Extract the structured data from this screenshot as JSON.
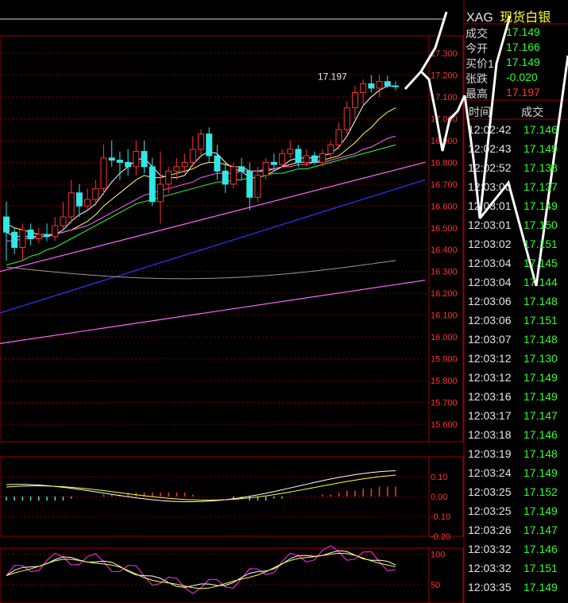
{
  "header": {
    "symbol": "XAG",
    "name": "现货白银"
  },
  "quote": [
    {
      "label": "成交",
      "value": "17.149",
      "color": "#33ff33"
    },
    {
      "label": "今开",
      "value": "17.166",
      "color": "#33ff33"
    },
    {
      "label": "买价1",
      "value": "17.149",
      "color": "#33ff33"
    },
    {
      "label": "张跌",
      "value": "-0.020",
      "color": "#33ff33"
    },
    {
      "label": "最高",
      "value": "17.197",
      "color": "#ff3333"
    }
  ],
  "ticks_header": {
    "time": "时间",
    "volume": "成交"
  },
  "ticks": [
    {
      "time": "12:02:42",
      "price": "17.146"
    },
    {
      "time": "12:02:43",
      "price": "17.149"
    },
    {
      "time": "12:02:52",
      "price": "17.138"
    },
    {
      "time": "12:03:00",
      "price": "17.137"
    },
    {
      "time": "12:03:01",
      "price": "17.149"
    },
    {
      "time": "12:03:01",
      "price": "17.150"
    },
    {
      "time": "12:03:02",
      "price": "17.151"
    },
    {
      "time": "12:03:04",
      "price": "17.145"
    },
    {
      "time": "12:03:04",
      "price": "17.144"
    },
    {
      "time": "12:03:06",
      "price": "17.148"
    },
    {
      "time": "12:03:06",
      "price": "17.151"
    },
    {
      "time": "12:03:07",
      "price": "17.148"
    },
    {
      "time": "12:03:12",
      "price": "17.130"
    },
    {
      "time": "12:03:12",
      "price": "17.149"
    },
    {
      "time": "12:03:16",
      "price": "17.149"
    },
    {
      "time": "12:03:17",
      "price": "17.147"
    },
    {
      "time": "12:03:18",
      "price": "17.146"
    },
    {
      "time": "12:03:19",
      "price": "17.148"
    },
    {
      "time": "12:03:24",
      "price": "17.149"
    },
    {
      "time": "12:03:25",
      "price": "17.152"
    },
    {
      "time": "12:03:25",
      "price": "17.149"
    },
    {
      "time": "12:03:26",
      "price": "17.147"
    },
    {
      "time": "12:03:32",
      "price": "17.146"
    },
    {
      "time": "12:03:32",
      "price": "17.151"
    },
    {
      "time": "12:03:35",
      "price": "17.149"
    }
  ],
  "chart_data": [
    {
      "type": "candlestick",
      "ylim": [
        15.52,
        17.38
      ],
      "y_ticks": [
        "17.300",
        "17.200",
        "17.100",
        "17.000",
        "16.900",
        "16.800",
        "16.700",
        "16.600",
        "16.500",
        "16.400",
        "16.300",
        "16.200",
        "16.100",
        "16.000",
        "15.900",
        "15.800",
        "15.700",
        "15.600"
      ],
      "annotation": "17.197",
      "candles": [
        {
          "o": 16.55,
          "h": 16.62,
          "l": 16.35,
          "c": 16.48
        },
        {
          "o": 16.48,
          "h": 16.5,
          "l": 16.38,
          "c": 16.41
        },
        {
          "o": 16.41,
          "h": 16.52,
          "l": 16.35,
          "c": 16.49
        },
        {
          "o": 16.49,
          "h": 16.52,
          "l": 16.42,
          "c": 16.45
        },
        {
          "o": 16.45,
          "h": 16.5,
          "l": 16.43,
          "c": 16.47
        },
        {
          "o": 16.47,
          "h": 16.52,
          "l": 16.44,
          "c": 16.46
        },
        {
          "o": 16.46,
          "h": 16.55,
          "l": 16.44,
          "c": 16.51
        },
        {
          "o": 16.51,
          "h": 16.62,
          "l": 16.49,
          "c": 16.55
        },
        {
          "o": 16.55,
          "h": 16.72,
          "l": 16.52,
          "c": 16.66
        },
        {
          "o": 16.66,
          "h": 16.7,
          "l": 16.55,
          "c": 16.6
        },
        {
          "o": 16.6,
          "h": 16.68,
          "l": 16.58,
          "c": 16.63
        },
        {
          "o": 16.63,
          "h": 16.72,
          "l": 16.6,
          "c": 16.68
        },
        {
          "o": 16.68,
          "h": 16.88,
          "l": 16.65,
          "c": 16.82
        },
        {
          "o": 16.82,
          "h": 16.9,
          "l": 16.78,
          "c": 16.81
        },
        {
          "o": 16.81,
          "h": 16.85,
          "l": 16.72,
          "c": 16.8
        },
        {
          "o": 16.8,
          "h": 16.86,
          "l": 16.74,
          "c": 16.78
        },
        {
          "o": 16.78,
          "h": 16.9,
          "l": 16.74,
          "c": 16.85
        },
        {
          "o": 16.85,
          "h": 16.9,
          "l": 16.75,
          "c": 16.78
        },
        {
          "o": 16.78,
          "h": 16.82,
          "l": 16.6,
          "c": 16.62
        },
        {
          "o": 16.62,
          "h": 16.85,
          "l": 16.52,
          "c": 16.7
        },
        {
          "o": 16.7,
          "h": 16.78,
          "l": 16.66,
          "c": 16.76
        },
        {
          "o": 16.76,
          "h": 16.82,
          "l": 16.72,
          "c": 16.78
        },
        {
          "o": 16.78,
          "h": 16.84,
          "l": 16.75,
          "c": 16.8
        },
        {
          "o": 16.8,
          "h": 16.92,
          "l": 16.78,
          "c": 16.86
        },
        {
          "o": 16.86,
          "h": 16.95,
          "l": 16.82,
          "c": 16.93
        },
        {
          "o": 16.93,
          "h": 16.96,
          "l": 16.8,
          "c": 16.83
        },
        {
          "o": 16.83,
          "h": 16.88,
          "l": 16.72,
          "c": 16.76
        },
        {
          "o": 16.76,
          "h": 16.8,
          "l": 16.66,
          "c": 16.7
        },
        {
          "o": 16.7,
          "h": 16.8,
          "l": 16.68,
          "c": 16.78
        },
        {
          "o": 16.78,
          "h": 16.82,
          "l": 16.72,
          "c": 16.76
        },
        {
          "o": 16.76,
          "h": 16.8,
          "l": 16.58,
          "c": 16.64
        },
        {
          "o": 16.64,
          "h": 16.78,
          "l": 16.62,
          "c": 16.74
        },
        {
          "o": 16.74,
          "h": 16.82,
          "l": 16.72,
          "c": 16.8
        },
        {
          "o": 16.8,
          "h": 16.84,
          "l": 16.76,
          "c": 16.79
        },
        {
          "o": 16.79,
          "h": 16.86,
          "l": 16.78,
          "c": 16.84
        },
        {
          "o": 16.84,
          "h": 16.9,
          "l": 16.82,
          "c": 16.86
        },
        {
          "o": 16.86,
          "h": 16.88,
          "l": 16.78,
          "c": 16.8
        },
        {
          "o": 16.8,
          "h": 16.86,
          "l": 16.78,
          "c": 16.83
        },
        {
          "o": 16.83,
          "h": 16.85,
          "l": 16.79,
          "c": 16.8
        },
        {
          "o": 16.8,
          "h": 16.86,
          "l": 16.78,
          "c": 16.84
        },
        {
          "o": 16.84,
          "h": 16.9,
          "l": 16.82,
          "c": 16.88
        },
        {
          "o": 16.88,
          "h": 16.98,
          "l": 16.86,
          "c": 16.95
        },
        {
          "o": 16.95,
          "h": 17.08,
          "l": 16.93,
          "c": 17.05
        },
        {
          "o": 17.05,
          "h": 17.15,
          "l": 17.0,
          "c": 17.12
        },
        {
          "o": 17.12,
          "h": 17.18,
          "l": 17.06,
          "c": 17.16
        },
        {
          "o": 17.16,
          "h": 17.2,
          "l": 17.12,
          "c": 17.14
        },
        {
          "o": 17.14,
          "h": 17.2,
          "l": 17.1,
          "c": 17.17
        },
        {
          "o": 17.17,
          "h": 17.197,
          "l": 17.14,
          "c": 17.15
        },
        {
          "o": 17.15,
          "h": 17.17,
          "l": 17.13,
          "c": 17.149
        }
      ],
      "ma_lines": [
        {
          "color": "#ffffff",
          "y": [
            16.48,
            16.46,
            16.46,
            16.46,
            16.46,
            16.46,
            16.47,
            16.49,
            16.53,
            16.56,
            16.58,
            16.61,
            16.66,
            16.71,
            16.75,
            16.78,
            16.81,
            16.82,
            16.78,
            16.74,
            16.73,
            16.73,
            16.74,
            16.79,
            16.83,
            16.85,
            16.84,
            16.8,
            16.77,
            16.76,
            16.73,
            16.73,
            16.74,
            16.76,
            16.78,
            16.81,
            16.82,
            16.82,
            16.82,
            16.83,
            16.84,
            16.87,
            16.92,
            16.99,
            17.06,
            17.1,
            17.13,
            17.15,
            17.15
          ]
        },
        {
          "color": "#ffff66",
          "y": [
            16.52,
            16.5,
            16.49,
            16.48,
            16.47,
            16.47,
            16.47,
            16.48,
            16.49,
            16.51,
            16.53,
            16.56,
            16.6,
            16.63,
            16.66,
            16.69,
            16.72,
            16.74,
            16.73,
            16.73,
            16.74,
            16.75,
            16.76,
            16.77,
            16.79,
            16.8,
            16.8,
            16.79,
            16.78,
            16.78,
            16.76,
            16.76,
            16.76,
            16.77,
            16.78,
            16.79,
            16.8,
            16.8,
            16.8,
            16.81,
            16.82,
            16.83,
            16.86,
            16.89,
            16.93,
            16.96,
            17.0,
            17.03,
            17.05
          ]
        },
        {
          "color": "#ff66ff",
          "y": [
            16.44,
            16.44,
            16.45,
            16.45,
            16.46,
            16.46,
            16.47,
            16.48,
            16.49,
            16.5,
            16.51,
            16.53,
            16.55,
            16.57,
            16.59,
            16.61,
            16.63,
            16.65,
            16.66,
            16.67,
            16.68,
            16.69,
            16.7,
            16.71,
            16.73,
            16.74,
            16.75,
            16.75,
            16.75,
            16.76,
            16.76,
            16.76,
            16.77,
            16.77,
            16.78,
            16.78,
            16.79,
            16.79,
            16.8,
            16.8,
            16.81,
            16.82,
            16.83,
            16.84,
            16.86,
            16.87,
            16.89,
            16.91,
            16.92
          ]
        },
        {
          "color": "#33ff33",
          "y": [
            16.33,
            16.34,
            16.35,
            16.37,
            16.38,
            16.4,
            16.41,
            16.43,
            16.45,
            16.47,
            16.49,
            16.51,
            16.53,
            16.55,
            16.57,
            16.59,
            16.61,
            16.62,
            16.63,
            16.64,
            16.65,
            16.66,
            16.67,
            16.68,
            16.69,
            16.7,
            16.71,
            16.71,
            16.72,
            16.72,
            16.73,
            16.73,
            16.74,
            16.75,
            16.75,
            16.76,
            16.77,
            16.77,
            16.78,
            16.79,
            16.8,
            16.81,
            16.82,
            16.83,
            16.84,
            16.85,
            16.86,
            16.87,
            16.88
          ]
        }
      ],
      "trend_lines": [
        {
          "color": "#ff66ff",
          "from": 16.3,
          "to": 16.8
        },
        {
          "color": "#ff66ff",
          "from": 15.97,
          "to": 16.26
        },
        {
          "color": "#3333ff",
          "from": 16.11,
          "to": 16.72
        },
        {
          "color": "#999999",
          "from": 16.32,
          "to": 16.35
        }
      ]
    },
    {
      "type": "macd",
      "ylim": [
        -0.2,
        0.2
      ],
      "y_ticks": [
        "0.10",
        "0.00",
        "-0.10",
        "-0.20"
      ],
      "hist": [
        -0.02,
        -0.02,
        -0.02,
        -0.02,
        -0.02,
        -0.02,
        -0.02,
        -0.02,
        -0.01,
        0,
        0,
        0,
        0.01,
        0.01,
        0.01,
        0.02,
        0.02,
        0.02,
        0.02,
        0.02,
        0.02,
        0.02,
        0.02,
        0.01,
        0,
        0,
        0,
        0,
        -0.01,
        -0.01,
        -0.02,
        -0.02,
        -0.02,
        -0.01,
        -0.01,
        0,
        0,
        0,
        0,
        0.01,
        0.01,
        0.02,
        0.03,
        0.03,
        0.04,
        0.04,
        0.05,
        0.05,
        0.05
      ]
    },
    {
      "type": "line",
      "ylim": [
        20,
        110
      ],
      "y_ticks": [
        "100",
        "50"
      ]
    }
  ]
}
